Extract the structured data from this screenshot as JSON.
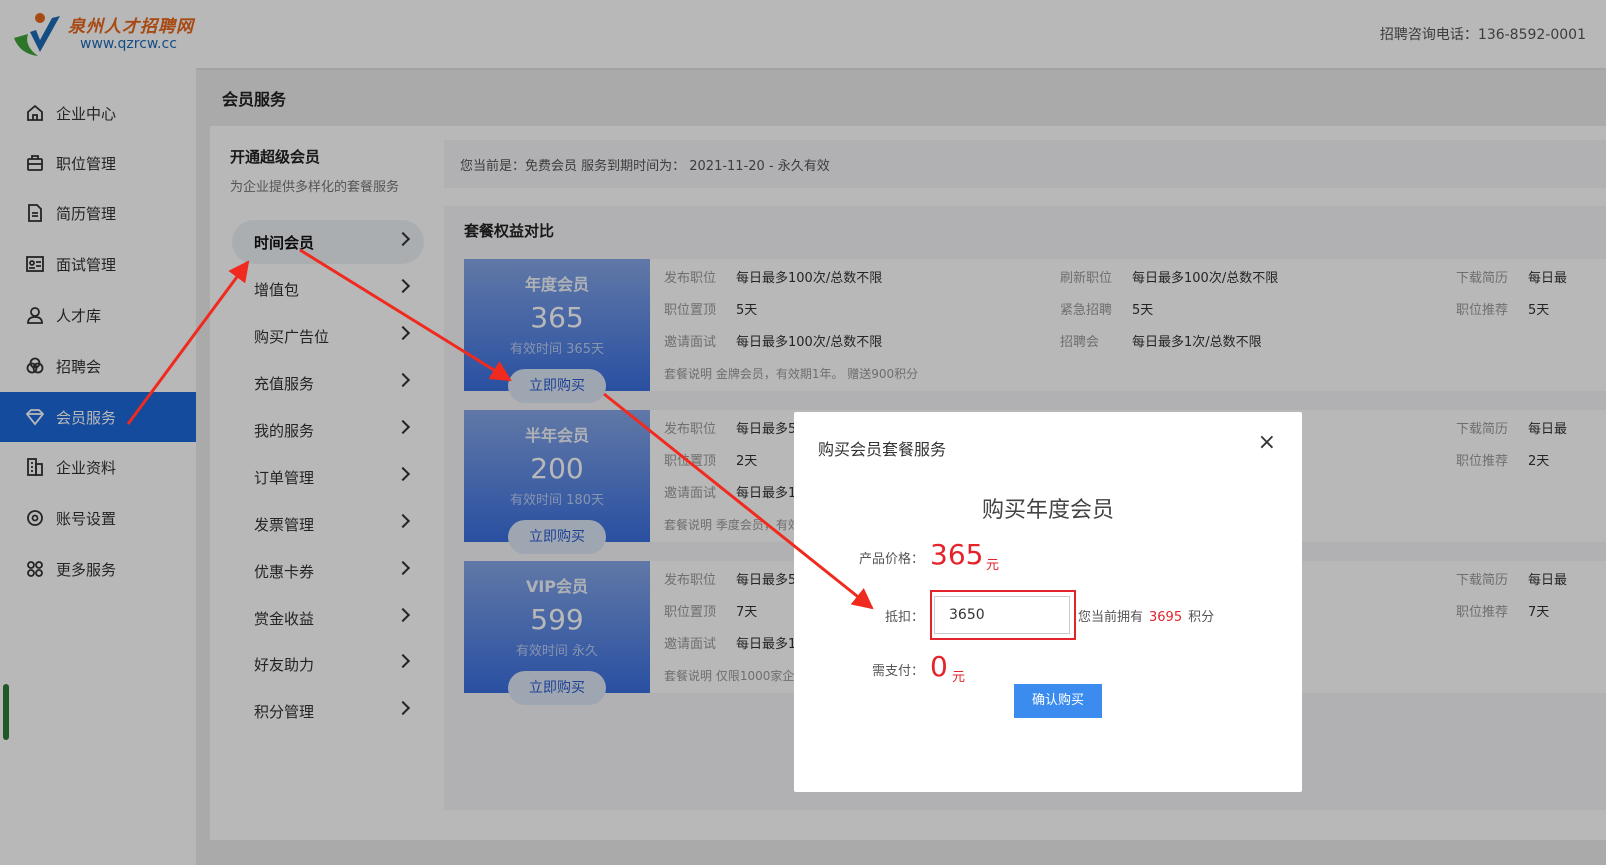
{
  "header": {
    "logo_title": "泉州人才招聘网",
    "logo_url": "www.qzrcw.cc",
    "hotline": "招聘咨询电话：136-8592-0001"
  },
  "sidebar": {
    "items": [
      {
        "label": "企业中心",
        "icon": "home-icon"
      },
      {
        "label": "职位管理",
        "icon": "briefcase-icon"
      },
      {
        "label": "简历管理",
        "icon": "document-icon"
      },
      {
        "label": "面试管理",
        "icon": "id-card-icon"
      },
      {
        "label": "人才库",
        "icon": "user-icon"
      },
      {
        "label": "招聘会",
        "icon": "venn-icon"
      },
      {
        "label": "会员服务",
        "icon": "diamond-icon",
        "active": true
      },
      {
        "label": "企业资料",
        "icon": "building-icon"
      },
      {
        "label": "账号设置",
        "icon": "settings-icon"
      },
      {
        "label": "更多服务",
        "icon": "apps-icon"
      }
    ]
  },
  "page": {
    "title": "会员服务"
  },
  "submenu": {
    "title": "开通超级会员",
    "desc": "为企业提供多样化的套餐服务",
    "items": [
      "时间会员",
      "增值包",
      "购买广告位",
      "充值服务",
      "我的服务",
      "订单管理",
      "发票管理",
      "优惠卡券",
      "赏金收益",
      "好友助力",
      "积分管理"
    ]
  },
  "status": {
    "text": "您当前是：免费会员 服务到期时间为： 2021-11-20 - 永久有效"
  },
  "compare": {
    "title": "套餐权益对比",
    "buy_label": "立即购买",
    "packages": [
      {
        "name": "年度会员",
        "price": "365",
        "valid": "有效时间 365天",
        "features": [
          [
            "发布职位",
            "每日最多100次/总数不限"
          ],
          [
            "刷新职位",
            "每日最多100次/总数不限"
          ],
          [
            "下载简历",
            "每日最"
          ],
          [
            "职位置顶",
            "5天"
          ],
          [
            "紧急招聘",
            "5天"
          ],
          [
            "职位推荐",
            "5天"
          ],
          [
            "邀请面试",
            "每日最多100次/总数不限"
          ],
          [
            "招聘会",
            "每日最多1次/总数不限"
          ]
        ],
        "desc": "套餐说明 金牌会员，有效期1年。 赠送900积分"
      },
      {
        "name": "半年会员",
        "price": "200",
        "valid": "有效时间 180天",
        "features": [
          [
            "发布职位",
            "每日最多5"
          ],
          [
            "下载简历",
            "每日最"
          ],
          [
            "职位置顶",
            "2天"
          ],
          [
            "职位推荐",
            "2天"
          ],
          [
            "邀请面试",
            "每日最多1"
          ]
        ],
        "desc": "套餐说明 季度会员，有效"
      },
      {
        "name": "VIP会员",
        "price": "599",
        "valid": "有效时间 永久",
        "features": [
          [
            "发布职位",
            "每日最多5"
          ],
          [
            "下载简历",
            "每日最"
          ],
          [
            "职位置顶",
            "7天"
          ],
          [
            "职位推荐",
            "7天"
          ],
          [
            "邀请面试",
            "每日最多1"
          ]
        ],
        "desc": "套餐说明 仅限1000家企业"
      }
    ]
  },
  "modal": {
    "title": "购买会员套餐服务",
    "close": "×",
    "heading": "购买年度会员",
    "price_label": "产品价格：",
    "price": "365",
    "unit": "元",
    "deduct_label": "抵扣：",
    "deduct_value": "3650",
    "own_prefix": "您当前拥有",
    "own_points": "3695",
    "own_suffix": "积分",
    "pay_label": "需支付：",
    "pay_amount": "0",
    "confirm": "确认购买"
  },
  "colors": {
    "accent": "#1d68d8",
    "price_red": "#e4242b",
    "arrow_red": "#f02a1e"
  }
}
